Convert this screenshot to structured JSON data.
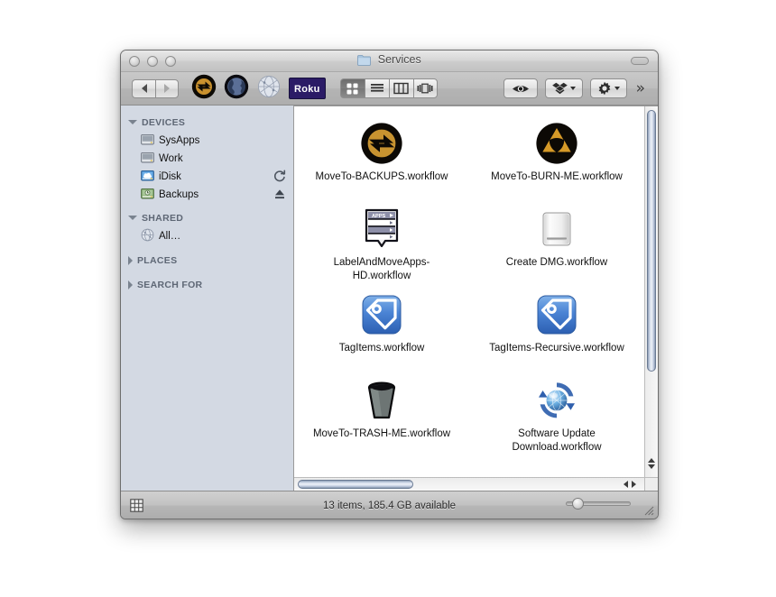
{
  "window": {
    "title": "Services",
    "title_icon": "folder-icon",
    "traffic_lights": [
      "close-button",
      "minimize-button",
      "zoom-button"
    ]
  },
  "toolbar": {
    "back_label": "Back",
    "forward_label": "Forward",
    "custom_items": [
      {
        "name": "moveto-backups-toolbar-icon",
        "label": ""
      },
      {
        "name": "globe-dark-toolbar-icon",
        "label": ""
      },
      {
        "name": "globe-light-toolbar-icon",
        "label": ""
      },
      {
        "name": "roku-toolbar-icon",
        "label": "Roku"
      }
    ],
    "view_modes": [
      {
        "name": "icon-view",
        "label": "Icon View",
        "selected": true
      },
      {
        "name": "list-view",
        "label": "List View",
        "selected": false
      },
      {
        "name": "column-view",
        "label": "Column View",
        "selected": false
      },
      {
        "name": "coverflow-view",
        "label": "Cover Flow View",
        "selected": false
      }
    ],
    "quicklook_label": "Quick Look",
    "dropbox_label": "Dropbox",
    "action_label": "Action",
    "overflow_label": "»"
  },
  "sidebar": {
    "groups": [
      {
        "name": "devices",
        "label": "DEVICES",
        "expanded": true,
        "items": [
          {
            "label": "SysApps",
            "icon": "hard-drive-icon",
            "badge": "none"
          },
          {
            "label": "Work",
            "icon": "hard-drive-icon",
            "badge": "none"
          },
          {
            "label": "iDisk",
            "icon": "idisk-icon",
            "badge": "sync-icon"
          },
          {
            "label": "Backups",
            "icon": "backup-disk-icon",
            "badge": "eject-icon"
          }
        ]
      },
      {
        "name": "shared",
        "label": "SHARED",
        "expanded": true,
        "items": [
          {
            "label": "All…",
            "icon": "network-globe-icon",
            "badge": "none"
          }
        ]
      },
      {
        "name": "places",
        "label": "PLACES",
        "expanded": false,
        "items": []
      },
      {
        "name": "search-for",
        "label": "SEARCH FOR",
        "expanded": false,
        "items": []
      }
    ]
  },
  "files": [
    {
      "name": "MoveTo-BACKUPS.workflow",
      "icon": "moveto-backups-icon"
    },
    {
      "name": "MoveTo-BURN-ME.workflow",
      "icon": "burn-radiation-icon"
    },
    {
      "name": "LabelAndMoveApps-HD.workflow",
      "icon": "apps-menu-list-icon"
    },
    {
      "name": "Create DMG.workflow",
      "icon": "disk-image-drive-icon"
    },
    {
      "name": "TagItems.workflow",
      "icon": "blue-tag-icon"
    },
    {
      "name": "TagItems-Recursive.workflow",
      "icon": "blue-tag-icon"
    },
    {
      "name": "MoveTo-TRASH-ME.workflow",
      "icon": "trash-can-icon"
    },
    {
      "name": "Software Update Download.workflow",
      "icon": "software-update-icon"
    }
  ],
  "status": {
    "text": "13 items, 185.4 GB available",
    "item_count": 13,
    "available": "185.4 GB",
    "grid_toggle_label": "Toggle Item Grid",
    "zoom_slider_label": "Icon Size"
  },
  "colors": {
    "sidebar_bg": "#d3d9e3",
    "content_bg": "#ffffff",
    "chrome": "#bdbdbd",
    "accent_tag": "#3a74c8",
    "burn_gold": "#e0a020",
    "roku_purple": "#2b1b66"
  }
}
